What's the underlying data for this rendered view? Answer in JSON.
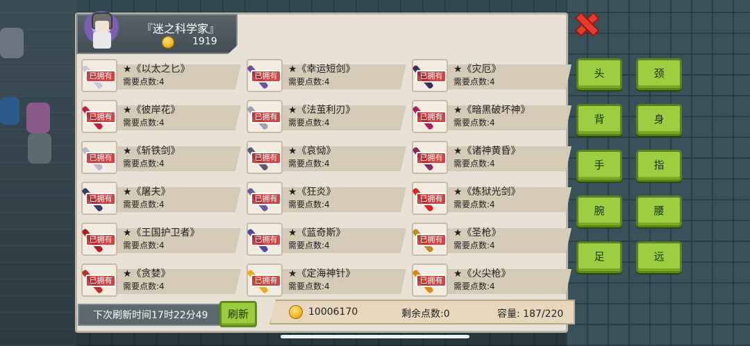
{
  "header": {
    "title": "『迷之科学家』",
    "gold": "1919"
  },
  "owned_label": "已拥有",
  "items": [
    {
      "name": "★《以太之匕》",
      "cost": "需要点数:4",
      "color": "#c8c8d8"
    },
    {
      "name": "★《幸运短剑》",
      "cost": "需要点数:4",
      "color": "#6a4fa8"
    },
    {
      "name": "★《灾厄》",
      "cost": "需要点数:4",
      "color": "#3b2f5c"
    },
    {
      "name": "★《彼岸花》",
      "cost": "需要点数:4",
      "color": "#c0203a"
    },
    {
      "name": "★《法茧利刃》",
      "cost": "需要点数:4",
      "color": "#9aa0b0"
    },
    {
      "name": "★《暗黑破坏神》",
      "cost": "需要点数:4",
      "color": "#b01d5c"
    },
    {
      "name": "★《斩铁剑》",
      "cost": "需要点数:4",
      "color": "#b8b8c8"
    },
    {
      "name": "★《哀恸》",
      "cost": "需要点数:4",
      "color": "#5a5a70"
    },
    {
      "name": "★《诸神黄昏》",
      "cost": "需要点数:4",
      "color": "#8a2a60"
    },
    {
      "name": "★《屠夫》",
      "cost": "需要点数:4",
      "color": "#3a3a66"
    },
    {
      "name": "★《狂炎》",
      "cost": "需要点数:4",
      "color": "#6a5aa0"
    },
    {
      "name": "★《炼狱光剑》",
      "cost": "需要点数:4",
      "color": "#e02020"
    },
    {
      "name": "★《王国护卫者》",
      "cost": "需要点数:4",
      "color": "#b81818"
    },
    {
      "name": "★《蓝奇斯》",
      "cost": "需要点数:4",
      "color": "#4a4aa0"
    },
    {
      "name": "★《圣枪》",
      "cost": "需要点数:4",
      "color": "#c08a20"
    },
    {
      "name": "★《贪婪》",
      "cost": "需要点数:4",
      "color": "#c42a2a"
    },
    {
      "name": "★《定海神针》",
      "cost": "需要点数:4",
      "color": "#e8b020"
    },
    {
      "name": "★《火尖枪》",
      "cost": "需要点数:4",
      "color": "#d88a14"
    }
  ],
  "bottom": {
    "refresh_text": "下次刷新时间17时22分49",
    "refresh_button": "刷新",
    "money": "10006170",
    "points": "剩余点数:0",
    "capacity": "容量:   187/220"
  },
  "categories": [
    "头",
    "颈",
    "背",
    "身",
    "手",
    "指",
    "腕",
    "腰",
    "足",
    "远"
  ],
  "icons": {
    "close": "close-x-icon",
    "coin": "gold-coin-icon"
  }
}
